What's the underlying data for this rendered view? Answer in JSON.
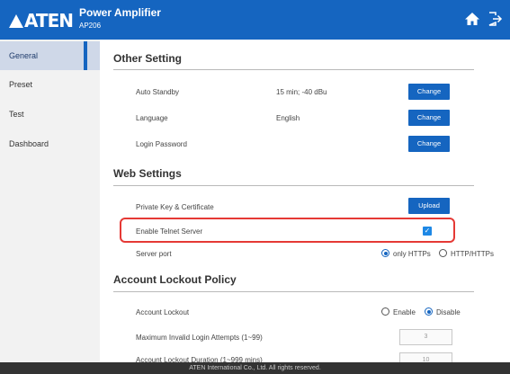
{
  "header": {
    "logo": "ATEN",
    "app_title": "Power Amplifier",
    "model": "AP206",
    "home_icon": "home-icon",
    "logout_icon": "logout-icon",
    "bg_color": "#1565c0"
  },
  "sidebar": {
    "items": [
      {
        "label": "General",
        "active": true
      },
      {
        "label": "Preset",
        "active": false
      },
      {
        "label": "Test",
        "active": false
      },
      {
        "label": "Dashboard",
        "active": false
      }
    ]
  },
  "other_setting": {
    "title": "Other Setting",
    "rows": [
      {
        "label": "Auto Standby",
        "value": "15 min; -40 dBu",
        "button": "Change"
      },
      {
        "label": "Language",
        "value": "English",
        "button": "Change"
      },
      {
        "label": "Login Password",
        "value": "",
        "button": "Change"
      }
    ]
  },
  "web_settings": {
    "title": "Web Settings",
    "private_key_label": "Private Key & Certificate",
    "upload_button": "Upload",
    "telnet_label": "Enable Telnet Server",
    "telnet_enabled": true,
    "server_port_label": "Server port",
    "port_options": [
      "only HTTPs",
      "HTTP/HTTPs"
    ],
    "port_selected": "only HTTPs"
  },
  "account_lockout": {
    "title": "Account Lockout Policy",
    "lockout_label": "Account Lockout",
    "lockout_options": [
      "Enable",
      "Disable"
    ],
    "lockout_selected": "Disable",
    "max_attempts_label": "Maximum Invalid Login Attempts (1~99)",
    "max_attempts_value": "3",
    "duration_label": "Account Lockout Duration (1~999 mins)",
    "duration_value": "10"
  },
  "footer": {
    "text": "ATEN International Co., Ltd. All rights reserved."
  },
  "colors": {
    "accent": "#1565c0",
    "highlight": "#e53935",
    "sidebar_bg": "#f2f2f2"
  }
}
